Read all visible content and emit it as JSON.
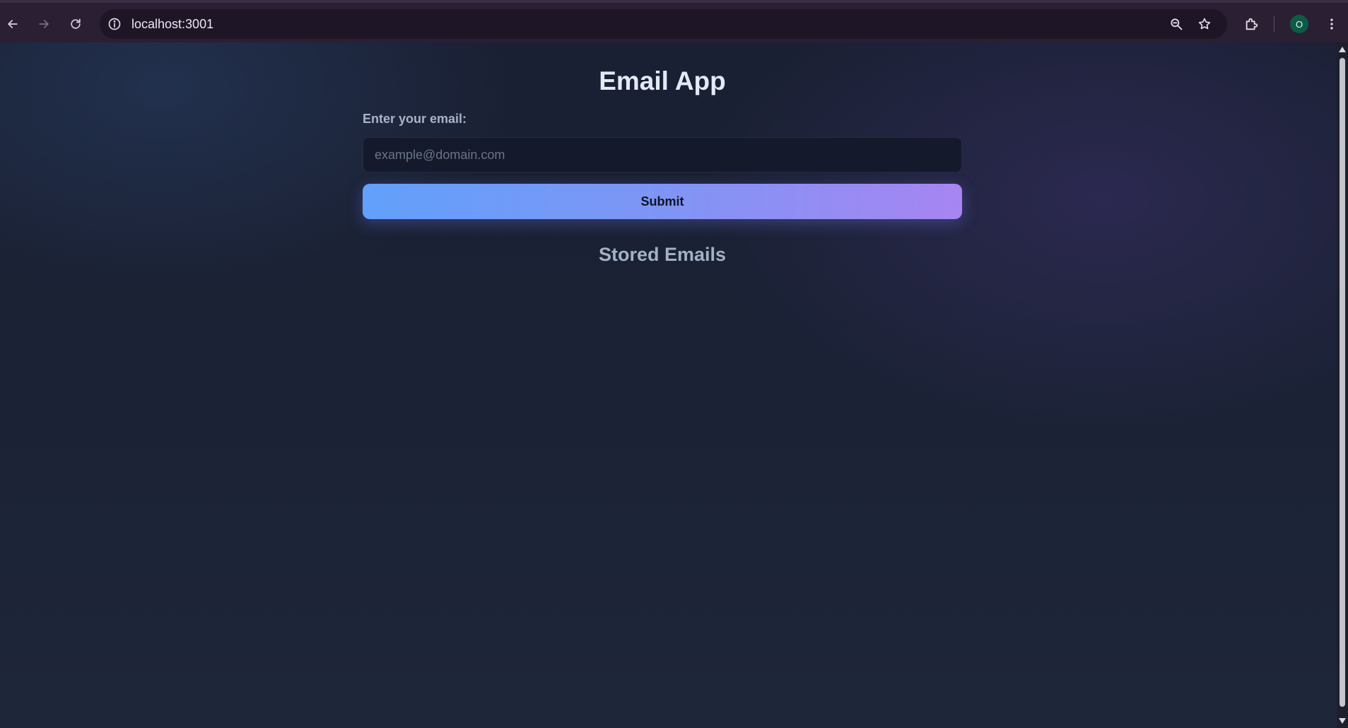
{
  "browser": {
    "url": "localhost:3001",
    "profile_initial": "O",
    "icons": {
      "back": "arrow-left-icon",
      "forward": "arrow-right-icon",
      "reload": "reload-icon",
      "site_info": "info-icon",
      "zoom": "magnifier-icon",
      "bookmark": "star-icon",
      "extensions": "puzzle-icon",
      "menu": "kebab-menu-icon"
    }
  },
  "app": {
    "title": "Email App",
    "email_label": "Enter your email:",
    "email_placeholder": "example@domain.com",
    "email_value": "",
    "submit_label": "Submit",
    "stored_title": "Stored Emails",
    "stored_emails": []
  },
  "colors": {
    "background": "#1c2336",
    "title": "#e4e9f5",
    "label": "#a8b3c7",
    "input_bg": "#141a2b",
    "button_gradient_start": "#61a0fb",
    "button_gradient_end": "#a785f2",
    "button_text": "#0d1324",
    "avatar_bg": "#0d5b45"
  }
}
